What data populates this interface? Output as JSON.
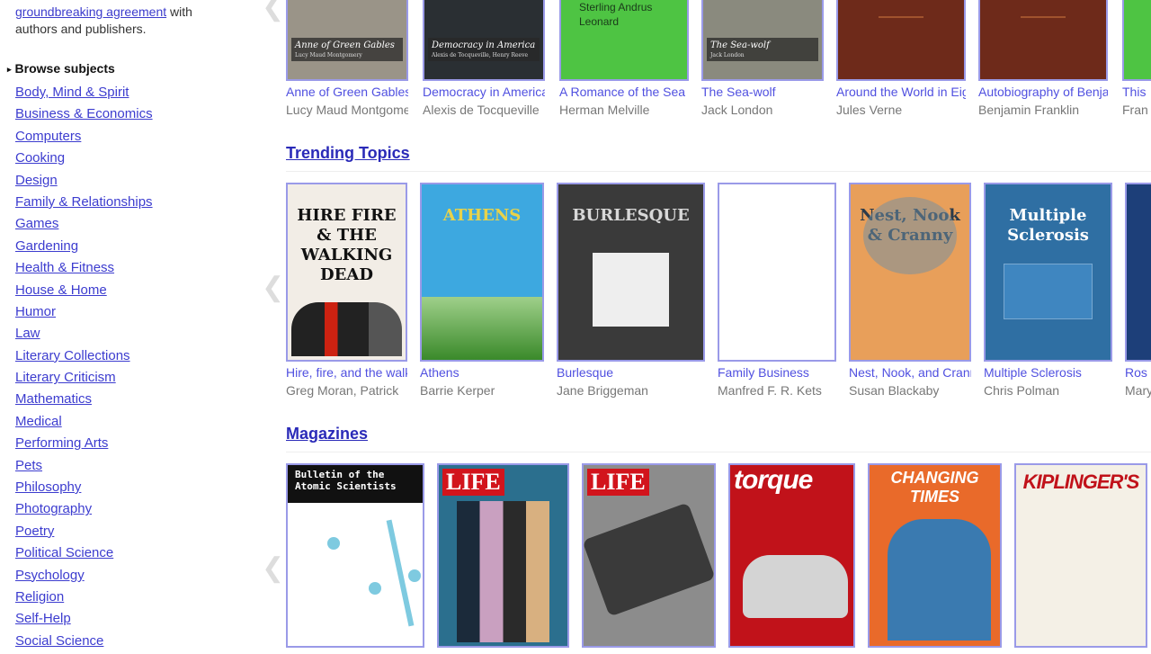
{
  "sidebar": {
    "intro_link": "groundbreaking agreement",
    "intro_after": " with",
    "intro_line2": "authors and publishers.",
    "browse_heading": "Browse subjects",
    "subjects": [
      "Body, Mind & Spirit",
      "Business & Economics",
      "Computers",
      "Cooking",
      "Design",
      "Family & Relationships",
      "Games",
      "Gardening",
      "Health & Fitness",
      "House & Home",
      "Humor",
      "Law",
      "Literary Collections",
      "Literary Criticism",
      "Mathematics",
      "Medical",
      "Performing Arts",
      "Pets",
      "Philosophy",
      "Photography",
      "Poetry",
      "Political Science",
      "Psychology",
      "Religion",
      "Self-Help",
      "Social Science"
    ]
  },
  "classics": {
    "books": [
      {
        "title": "Anne of Green Gables",
        "author": "Lucy Maud Montgomery",
        "cover_color": "#9a9488",
        "cover_title": "Anne of Green Gables",
        "cover_author": "Lucy Maud Montgomery"
      },
      {
        "title": "Democracy in America",
        "author": "Alexis de Tocqueville",
        "cover_color": "#2a2f33",
        "cover_title": "Democracy in America",
        "cover_author": "Alexis de Tocqueville, Henry Reeve"
      },
      {
        "title": "A Romance of the Sea",
        "author": "Herman Melville",
        "cover_color": "#4ec443",
        "cover_title": "Sterling Andrus Leonard",
        "cover_author": ""
      },
      {
        "title": "The Sea-wolf",
        "author": "Jack London",
        "cover_color": "#8a8a7e",
        "cover_title": "The Sea-wolf",
        "cover_author": "Jack London"
      },
      {
        "title": "Around the World in Eighty Days",
        "author": "Jules Verne",
        "cover_color": "#6e2a1a",
        "cover_title": "",
        "cover_author": ""
      },
      {
        "title": "Autobiography of Benjamin Franklin",
        "author": "Benjamin Franklin",
        "cover_color": "#6e2a1a",
        "cover_title": "",
        "cover_author": ""
      },
      {
        "title": "This",
        "author": "Fran",
        "cover_color": "#4ec443",
        "cover_title": "",
        "cover_author": ""
      }
    ]
  },
  "trending": {
    "heading": "Trending Topics",
    "books": [
      {
        "title": "Hire, fire, and the walking dead",
        "author": "Greg Moran, Patrick",
        "cover_color": "#f2ede6",
        "cover_text": "HIRE FIRE & THE WALKING DEAD",
        "cover_text_color": "#111"
      },
      {
        "title": "Athens",
        "author": "Barrie Kerper",
        "cover_color": "#3da8e0",
        "cover_text": "ATHENS",
        "cover_text_color": "#e8d24a"
      },
      {
        "title": "Burlesque",
        "author": "Jane Briggeman",
        "cover_color": "#3a3a3a",
        "cover_text": "BURLESQUE",
        "cover_text_color": "#d8d8d8"
      },
      {
        "title": "Family Business",
        "author": "Manfred F. R. Kets",
        "cover_color": "#ffffff",
        "cover_text": "",
        "cover_text_color": "#111"
      },
      {
        "title": "Nest, Nook, and Cranny",
        "author": "Susan Blackaby",
        "cover_color": "#e89f5a",
        "cover_text": "Nest, Nook & Cranny",
        "cover_text_color": "#2c3b4a"
      },
      {
        "title": "Multiple Sclerosis",
        "author": "Chris Polman",
        "cover_color": "#2f6fa3",
        "cover_text": "Multiple Sclerosis",
        "cover_text_color": "#ffffff"
      },
      {
        "title": "Ros",
        "author": "Mary",
        "cover_color": "#1d3f79",
        "cover_text": "",
        "cover_text_color": "#fff"
      }
    ]
  },
  "magazines": {
    "heading": "Magazines",
    "items": [
      {
        "cover_color": "#ffffff",
        "cover_text": "Bulletin of the Atomic Scientists",
        "cover_text_color": "#111"
      },
      {
        "cover_color": "#2b6f8e",
        "cover_text": "LIFE",
        "cover_text_color": "#ffffff"
      },
      {
        "cover_color": "#8c8c8c",
        "cover_text": "LIFE",
        "cover_text_color": "#ffffff"
      },
      {
        "cover_color": "#c1121a",
        "cover_text": "torque",
        "cover_text_color": "#ffffff"
      },
      {
        "cover_color": "#e96a2a",
        "cover_text": "CHANGING TIMES",
        "cover_text_color": "#ffffff"
      },
      {
        "cover_color": "#f4f0e6",
        "cover_text": "KIPLINGER'S",
        "cover_text_color": "#c1121a"
      }
    ]
  }
}
